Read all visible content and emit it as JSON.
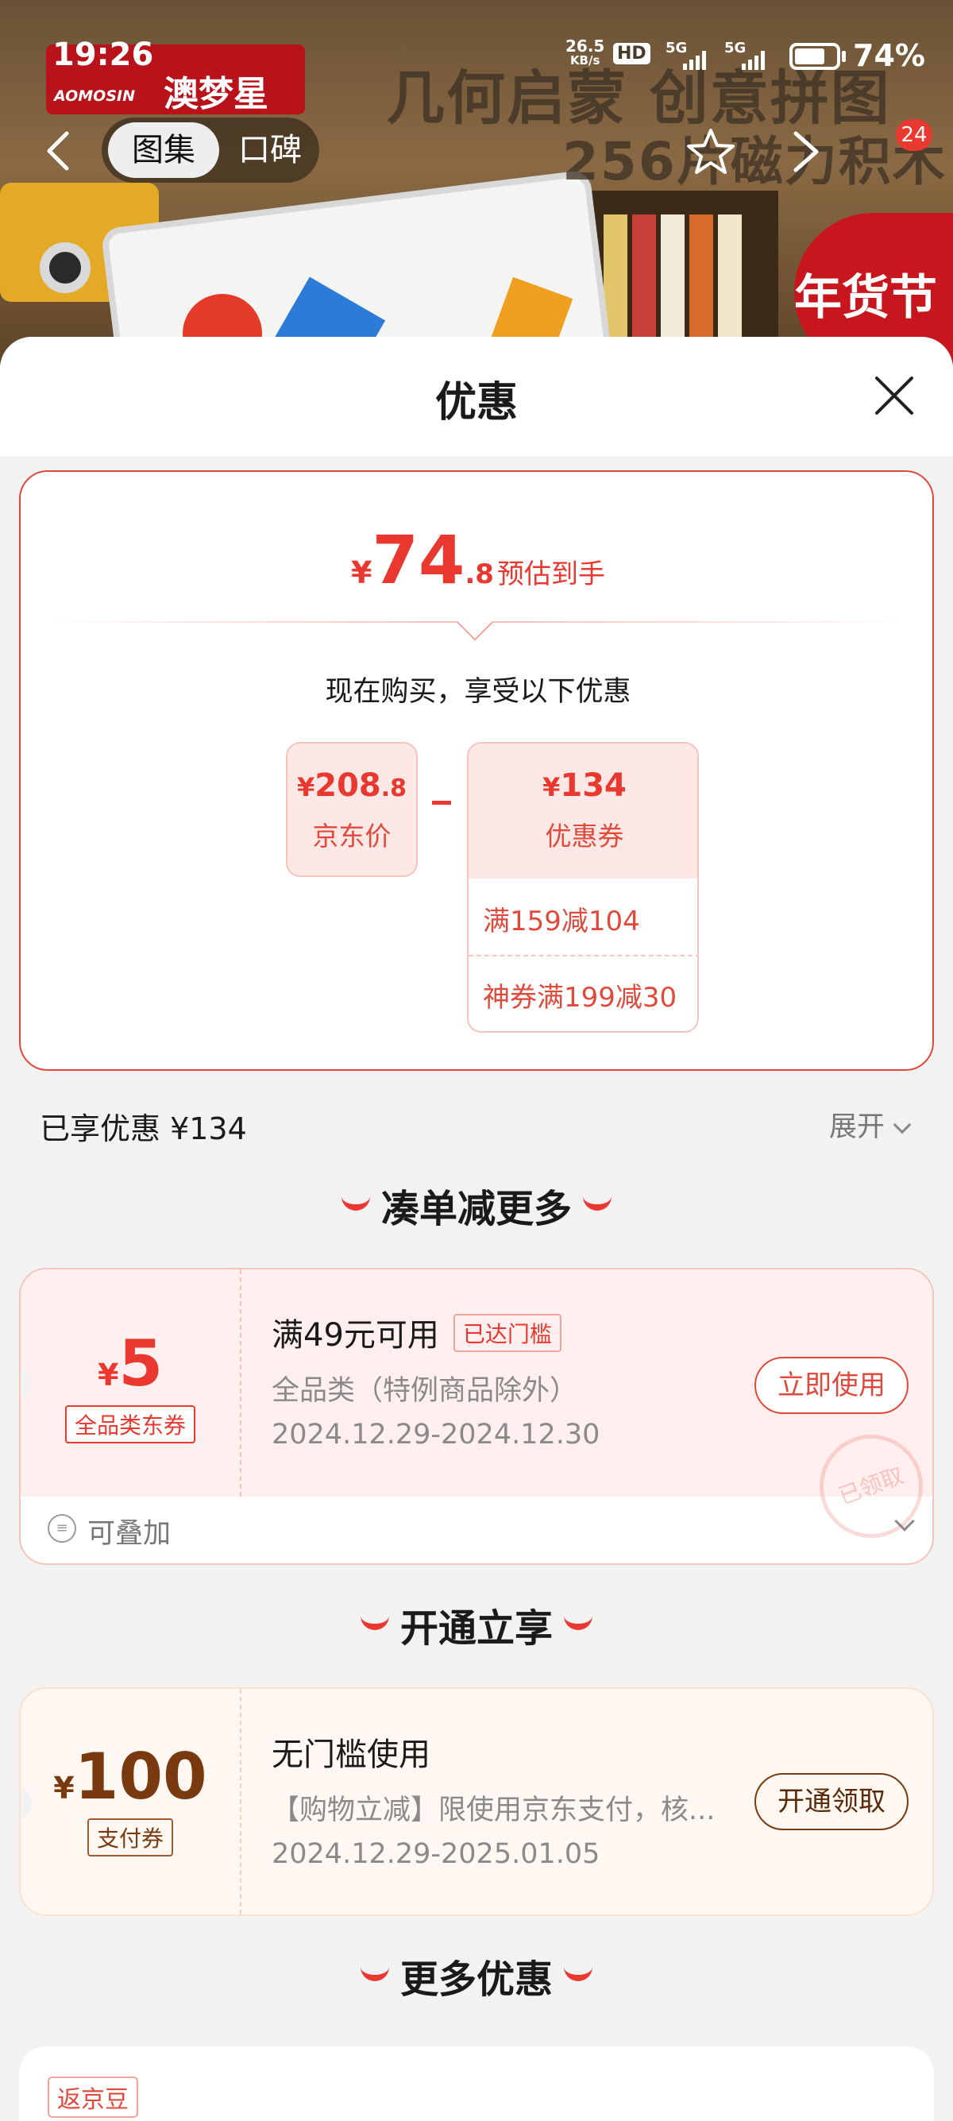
{
  "status_bar": {
    "time": "19:26",
    "speed_value": "26.5",
    "speed_unit": "KB/s",
    "hd": "HD",
    "net1": "5G",
    "net2": "5G",
    "battery_percent": 74,
    "battery_text": "74%"
  },
  "banner": {
    "brand_en": "AOMOSIN",
    "brand_cn": "澳梦星",
    "headline_line1": "几何启蒙 创意拼图",
    "headline_line2": "256片磁力积木",
    "festival_label": "年货节",
    "tabs": [
      {
        "label": "图集",
        "active": true
      },
      {
        "label": "口碑",
        "active": false
      }
    ],
    "image_count": "24"
  },
  "sheet": {
    "title": "优惠",
    "estimate": {
      "currency": "¥",
      "integer": "74",
      "decimal": ".8",
      "label": "预估到手"
    },
    "buy_now_text": "现在购买，享受以下优惠",
    "jd_price": {
      "currency": "¥",
      "integer": "208",
      "decimal": ".8",
      "label": "京东价"
    },
    "coupon_total": {
      "currency": "¥",
      "integer": "134",
      "label": "优惠券",
      "items": [
        "满159减104",
        "神券满199减30"
      ]
    },
    "enjoyed_text": "已享优惠 ¥134",
    "expand_label": "展开"
  },
  "section_bundle": {
    "title": "凑单减更多",
    "coupon": {
      "currency": "¥",
      "amount": "5",
      "tag": "全品类东券",
      "title": "满49元可用",
      "badge": "已达门槛",
      "desc": "全品类（特例商品除外）",
      "date": "2024.12.29-2024.12.30",
      "cta": "立即使用",
      "stamp": "已领取",
      "stackable": "可叠加"
    }
  },
  "section_open": {
    "title": "开通立享",
    "coupon": {
      "currency": "¥",
      "amount": "100",
      "tag": "支付券",
      "title": "无门槛使用",
      "desc": "【购物立减】限使用京东支付，核...",
      "date": "2024.12.29-2025.01.05",
      "cta": "开通领取"
    }
  },
  "section_more": {
    "title": "更多优惠",
    "first_tag": "返京豆"
  },
  "colors": {
    "accent": "#e8382f",
    "brown": "#7a3a10",
    "sheet_bg": "#f2f2f2"
  }
}
